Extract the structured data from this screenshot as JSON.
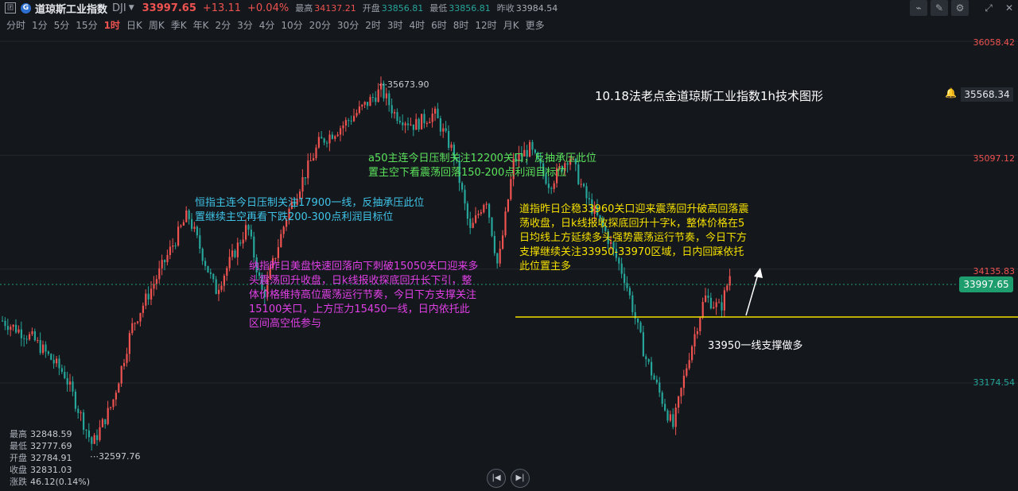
{
  "header": {
    "name": "道琼斯工业指数",
    "code": "DJI",
    "price": "33997.65",
    "change": "+13.11",
    "change_pct": "+0.04%",
    "high_label": "最高",
    "high_value": "34137.21",
    "open_label": "开盘",
    "open_value": "33856.81",
    "low_label": "最低",
    "low_value": "33856.81",
    "prev_label": "昨收",
    "prev_value": "33984.54"
  },
  "periods": [
    "分时",
    "1分",
    "5分",
    "15分",
    "1时",
    "日K",
    "周K",
    "季K",
    "年K",
    "2分",
    "3分",
    "4分",
    "10分",
    "20分",
    "30分",
    "2时",
    "3时",
    "4时",
    "6时",
    "8时",
    "12时",
    "月K",
    "更多"
  ],
  "active_period": "1时",
  "toolbar_icons": [
    "chart-type-icon",
    "draw-icon",
    "settings-icon",
    "expand-icon",
    "close-icon"
  ],
  "price_axis": {
    "labels": [
      "36058.42",
      "35097.12",
      "34135.83",
      "33174.54"
    ],
    "current_price": "33997.65",
    "alert_price": "35568.34"
  },
  "chart_markers": {
    "high": "35673.90",
    "low": "32597.76"
  },
  "title": "10.18法老点金道琼斯工业指数1h技术图形",
  "annotations": {
    "cyan": "恒指主连今日压制关注17900一线，反抽承压此位置继续主空再看下跌200-300点利润目标位",
    "green": "a50主连今日压制关注12200关口，反抽承压此位置主空下看震荡回落150-200点利润目标位",
    "magenta": "纳指昨日美盘快速回落向下刺破15050关口迎来多头震荡回升收盘，日k线报收探底回升长下引，整体价格维持高位震荡运行节奏，今日下方支撑关注15100关口，上方压力15450一线，日内依托此区间高空低参与",
    "yellow": "道指昨日企稳33960关口迎来震荡回升破高回落震荡收盘，日k线报收探底回升十字k，整体价格在5日均线上方延续多头强势震荡运行节奏，今日下方支撑继续关注33950-33970区域，日内回踩依托此位置主多",
    "support": "33950一线支撑做多"
  },
  "stats": [
    {
      "label": "最高",
      "value": "32848.59"
    },
    {
      "label": "最低",
      "value": "32777.69"
    },
    {
      "label": "开盘",
      "value": "32784.91"
    },
    {
      "label": "收盘",
      "value": "32831.03"
    },
    {
      "label": "涨跌",
      "value": "46.12(0.14%)"
    }
  ],
  "colors": {
    "up": "#ef5350",
    "down": "#26a69a",
    "background": "#14171c",
    "support_line": "#f5e000"
  }
}
